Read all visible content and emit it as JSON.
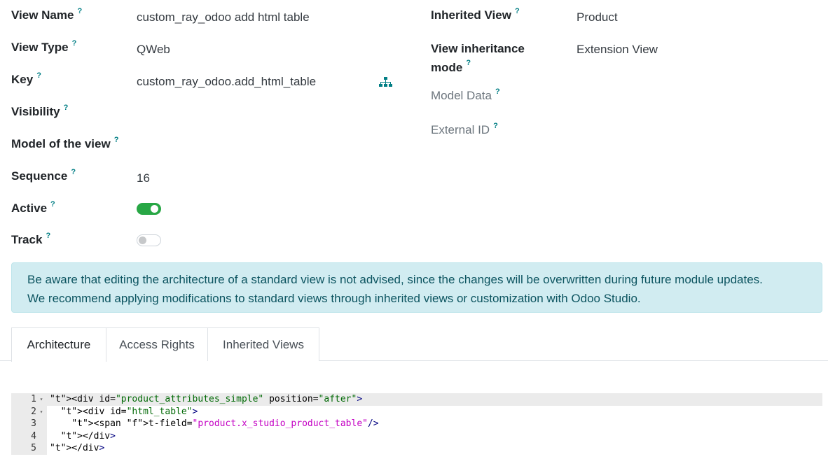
{
  "fields_left": {
    "view_name": {
      "label": "View Name",
      "value": "custom_ray_odoo add html table"
    },
    "view_type": {
      "label": "View Type",
      "value": "QWeb"
    },
    "key": {
      "label": "Key",
      "value": "custom_ray_odoo.add_html_table"
    },
    "visibility": {
      "label": "Visibility",
      "value": ""
    },
    "model_of_view": {
      "label": "Model of the view",
      "value": ""
    },
    "sequence": {
      "label": "Sequence",
      "value": "16"
    },
    "active": {
      "label": "Active",
      "value": true
    },
    "track": {
      "label": "Track",
      "value": false
    }
  },
  "fields_right": {
    "inherited_view": {
      "label": "Inherited View",
      "value": "Product"
    },
    "inheritance_mode": {
      "label_line1": "View inheritance",
      "label_line2": "mode",
      "value": "Extension View"
    },
    "model_data": {
      "label": "Model Data",
      "value": ""
    },
    "external_id": {
      "label": "External ID",
      "value": ""
    }
  },
  "help_marker": "?",
  "alert": {
    "line1": "Be aware that editing the architecture of a standard view is not advised, since the changes will be overwritten during future module updates.",
    "line2": "We recommend applying modifications to standard views through inherited views or customization with Odoo Studio."
  },
  "tabs": [
    {
      "label": "Architecture",
      "active": true
    },
    {
      "label": "Access Rights",
      "active": false
    },
    {
      "label": "Inherited Views",
      "active": false
    }
  ],
  "code": {
    "line_numbers": [
      "1",
      "2",
      "3",
      "4",
      "5"
    ],
    "lines": [
      "<div id=\"product_attributes_simple\" position=\"after\">",
      "  <div id=\"html_table\">",
      "    <span t-field=\"product.x_studio_product_table\"/>",
      "  </div>",
      "</div>"
    ],
    "fold_glyph": "▾"
  },
  "colors": {
    "accent": "#017e84",
    "toggle_on": "#28a745",
    "alert_bg": "#d1ecf1",
    "alert_text": "#0c5460"
  },
  "icons": {
    "key_action": "sitemap-icon"
  }
}
